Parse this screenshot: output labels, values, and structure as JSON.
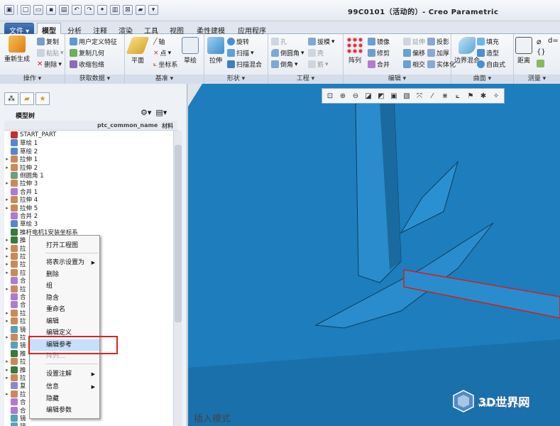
{
  "app": {
    "title": "99C0101（活动的）- Creo Parametric"
  },
  "ribbon": {
    "tabs": [
      "文件",
      "模型",
      "分析",
      "注释",
      "渲染",
      "工具",
      "视图",
      "柔性建模",
      "应用程序"
    ],
    "active_tab": "模型",
    "groups": {
      "operation": {
        "label": "操作",
        "items": [
          "重新生成",
          "复制",
          "粘贴",
          "删除"
        ]
      },
      "getdata": {
        "label": "获取数据",
        "items": [
          "用户定义特征",
          "复制几何",
          "收缩包络"
        ]
      },
      "datum": {
        "label": "基准",
        "items": [
          "平面",
          "轴",
          "点",
          "坐标系",
          "草绘"
        ]
      },
      "shape": {
        "label": "形状",
        "items": [
          "拉伸",
          "旋转",
          "扫描",
          "扫描混合"
        ]
      },
      "engineering": {
        "label": "工程",
        "items": [
          "孔",
          "拔模",
          "倒圆角",
          "壳",
          "倒角",
          "筋"
        ]
      },
      "editing": {
        "label": "编辑",
        "items": [
          "阵列",
          "镜像",
          "延伸",
          "投影",
          "修剪",
          "偏移",
          "加厚",
          "合并",
          "相交",
          "实体化"
        ]
      },
      "surface": {
        "label": "曲面",
        "items": [
          "边界混合",
          "填充",
          "造型",
          "自由式"
        ]
      },
      "measure": {
        "label": "测量",
        "items": [
          "距离"
        ]
      }
    }
  },
  "model_tree": {
    "title": "模型树",
    "columns": [
      "ptc_common_name",
      "材料"
    ],
    "items": [
      {
        "label": "START_PART",
        "expandable": false
      },
      {
        "label": "草绘 1",
        "expandable": false
      },
      {
        "label": "草绘 2",
        "expandable": false
      },
      {
        "label": "拉伸 1",
        "expandable": true
      },
      {
        "label": "拉伸 2",
        "expandable": true
      },
      {
        "label": "倒圆角 1",
        "expandable": false
      },
      {
        "label": "拉伸 3",
        "expandable": true
      },
      {
        "label": "合并 1",
        "expandable": false
      },
      {
        "label": "拉伸 4",
        "expandable": true
      },
      {
        "label": "拉伸 5",
        "expandable": true
      },
      {
        "label": "合并 2",
        "expandable": false
      },
      {
        "label": "草绘 3",
        "expandable": false
      },
      {
        "label": "推杆电机1安装坐标系",
        "expandable": false
      },
      {
        "label": "推",
        "expandable": true
      },
      {
        "label": "拉",
        "expandable": true
      },
      {
        "label": "拉",
        "expandable": true
      },
      {
        "label": "拉",
        "expandable": true
      },
      {
        "label": "拉",
        "expandable": true
      },
      {
        "label": "合",
        "expandable": false
      },
      {
        "label": "拉",
        "expandable": true
      },
      {
        "label": "合",
        "expandable": false
      },
      {
        "label": "合",
        "expandable": false
      },
      {
        "label": "拉",
        "expandable": true
      },
      {
        "label": "拉",
        "expandable": true
      },
      {
        "label": "镜",
        "expandable": false
      },
      {
        "label": "拉",
        "expandable": true
      },
      {
        "label": "镜",
        "expandable": false
      },
      {
        "label": "推",
        "expandable": false
      },
      {
        "label": "拉",
        "expandable": true
      },
      {
        "label": "推",
        "expandable": true
      },
      {
        "label": "拉",
        "expandable": true
      },
      {
        "label": "复",
        "expandable": false
      },
      {
        "label": "拉",
        "expandable": true
      },
      {
        "label": "合",
        "expandable": false
      },
      {
        "label": "合",
        "expandable": false
      },
      {
        "label": "镜",
        "expandable": false
      },
      {
        "label": "镜",
        "expandable": false
      },
      {
        "label": "合",
        "expandable": false
      },
      {
        "label": "拉伸 14",
        "expandable": true
      }
    ]
  },
  "context_menu": {
    "items": [
      {
        "label": "打开工程图",
        "submenu": false,
        "state": "normal"
      },
      {
        "label": "将表示设置为",
        "submenu": true,
        "state": "normal"
      },
      {
        "label": "删除",
        "submenu": false,
        "state": "normal"
      },
      {
        "label": "组",
        "submenu": false,
        "state": "normal"
      },
      {
        "label": "隐含",
        "submenu": false,
        "state": "normal"
      },
      {
        "label": "重命名",
        "submenu": false,
        "state": "normal"
      },
      {
        "label": "编辑",
        "submenu": false,
        "state": "normal"
      },
      {
        "label": "编辑定义",
        "submenu": false,
        "state": "normal"
      },
      {
        "label": "编辑参考",
        "submenu": false,
        "state": "selected"
      },
      {
        "label": "阵列...",
        "submenu": false,
        "state": "disabled"
      },
      {
        "label": "设置注解",
        "submenu": true,
        "state": "normal"
      },
      {
        "label": "信息",
        "submenu": true,
        "state": "normal"
      },
      {
        "label": "隐藏",
        "submenu": false,
        "state": "normal"
      },
      {
        "label": "编辑参数",
        "submenu": false,
        "state": "normal"
      }
    ]
  },
  "viewport": {
    "mode_text": "插入模式",
    "background_color": "#dfe3ea",
    "model_color": "#1f7fbd",
    "selection_color": "#e02020"
  },
  "watermark": {
    "text": "3D世界网",
    "url": "WWW.3DSJW.COM"
  }
}
